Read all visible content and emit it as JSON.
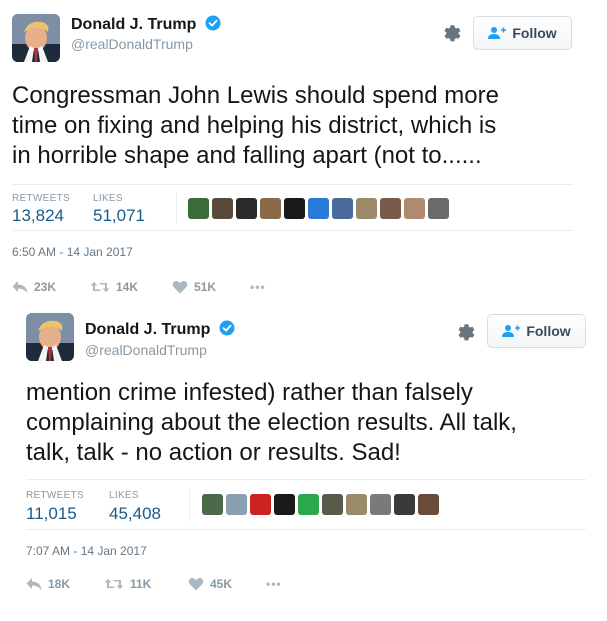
{
  "tweets": [
    {
      "author": {
        "name": "Donald J. Trump",
        "handle": "@realDonaldTrump"
      },
      "follow_label": "Follow",
      "text": [
        "Congressman John Lewis should spend more",
        "time on fixing and helping his district, which is",
        "in horrible shape and falling apart (not to......"
      ],
      "stats": {
        "retweets_label": "RETWEETS",
        "retweets": "13,824",
        "likes_label": "LIKES",
        "likes": "51,071"
      },
      "timestamp": "6:50 AM - 14 Jan 2017",
      "actions": {
        "reply": "23K",
        "retweet": "14K",
        "like": "51K",
        "more": "•••"
      },
      "liker_colors": [
        "#3a6b3a",
        "#5a4a3a",
        "#2a2a2a",
        "#8a6a4a",
        "#1a1a1a",
        "#2a7ad8",
        "#4a6a9a",
        "#9a8a6a",
        "#7a5a4a",
        "#b08a70",
        "#6a6a6a"
      ]
    },
    {
      "author": {
        "name": "Donald J. Trump",
        "handle": "@realDonaldTrump"
      },
      "follow_label": "Follow",
      "text": [
        "mention crime infested) rather than falsely",
        "complaining about the election results. All talk,",
        "talk, talk - no action or results. Sad!"
      ],
      "stats": {
        "retweets_label": "RETWEETS",
        "retweets": "11,015",
        "likes_label": "LIKES",
        "likes": "45,408"
      },
      "timestamp": "7:07 AM - 14 Jan 2017",
      "actions": {
        "reply": "18K",
        "retweet": "11K",
        "like": "45K",
        "more": "•••"
      },
      "liker_colors": [
        "#4a6a4a",
        "#8aa0b0",
        "#cc2222",
        "#1a1a1a",
        "#2aa84a",
        "#5a5a4a",
        "#9a8a6a",
        "#7a7a7a",
        "#3a3a3a",
        "#6a4a3a"
      ]
    }
  ],
  "colors": {
    "verified": "#1da1f2",
    "link": "#1a5a8a",
    "muted": "#8899a6"
  },
  "icons": [
    "verified-badge-icon",
    "gear-icon",
    "follow-person-icon",
    "reply-icon",
    "retweet-icon",
    "like-heart-icon",
    "more-dots-icon"
  ]
}
